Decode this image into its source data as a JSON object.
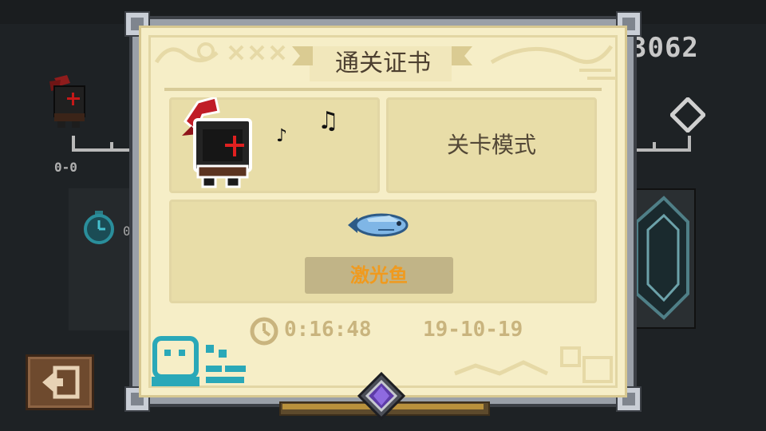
{
  "hud": {
    "score": "3062",
    "hero_counter": "0-0",
    "timer_value": "0",
    "exit_icon": "exit-door-icon"
  },
  "certificate": {
    "title": "通关证书",
    "mode": "关卡模式",
    "loot": {
      "name": "激光鱼",
      "icon": "laser-fish-icon"
    },
    "clear_time": "0:16:48",
    "date": "19-10-19",
    "hero_icon": "knight-icon",
    "notes_icon": "music-notes-icon"
  },
  "colors": {
    "paper": "#f6eec7",
    "box": "#e8dda8",
    "loot_name": "#f09a1e",
    "stamp": "#2aa8b8"
  }
}
